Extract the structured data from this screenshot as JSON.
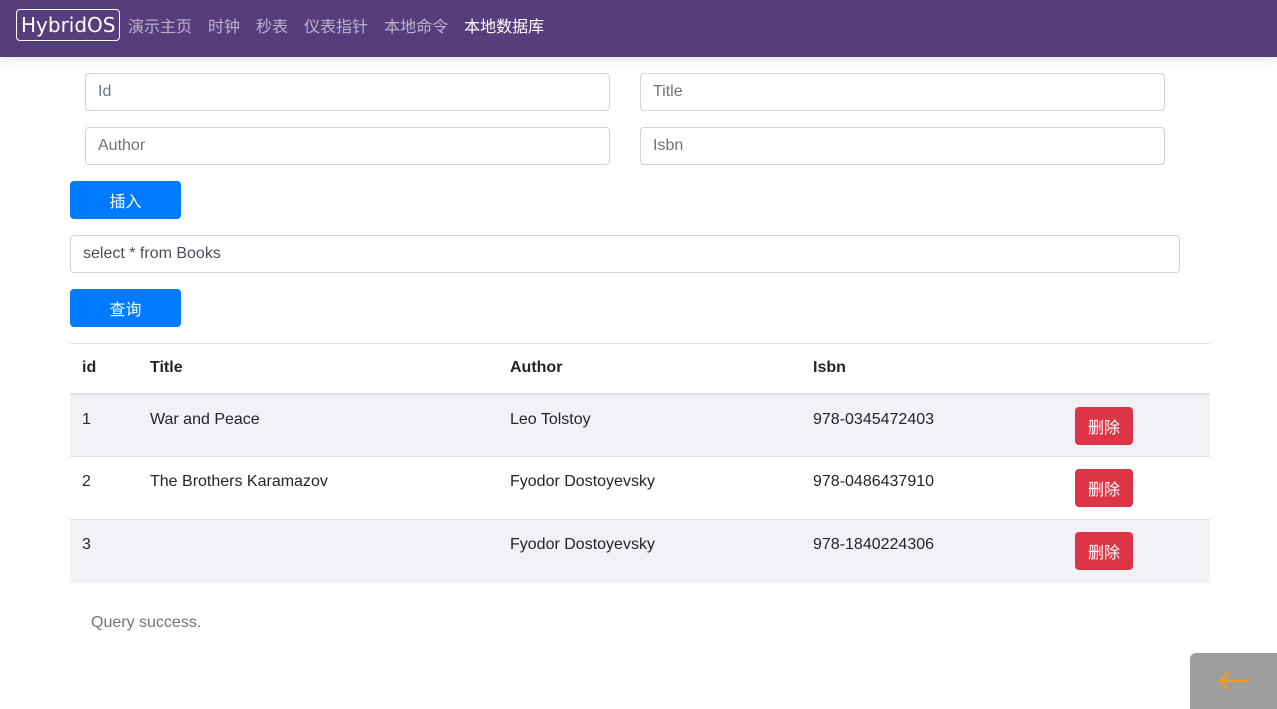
{
  "navbar": {
    "brand": "HybridOS",
    "links": [
      {
        "label": "演示主页",
        "active": false
      },
      {
        "label": "时钟",
        "active": false
      },
      {
        "label": "秒表",
        "active": false
      },
      {
        "label": "仪表指针",
        "active": false
      },
      {
        "label": "本地命令",
        "active": false
      },
      {
        "label": "本地数据库",
        "active": true
      }
    ]
  },
  "form": {
    "id": {
      "value": "",
      "placeholder": "Id"
    },
    "title": {
      "value": "",
      "placeholder": "Title"
    },
    "author": {
      "value": "",
      "placeholder": "Author"
    },
    "isbn": {
      "value": "",
      "placeholder": "Isbn"
    },
    "insert_label": "插入"
  },
  "query": {
    "value": "select * from Books",
    "button_label": "查询"
  },
  "table": {
    "headers": [
      "id",
      "Title",
      "Author",
      "Isbn"
    ],
    "rows": [
      {
        "id": "1",
        "title": "War and Peace",
        "author": "Leo Tolstoy",
        "isbn": "978-0345472403",
        "delete_label": "删除"
      },
      {
        "id": "2",
        "title": "The Brothers Karamazov",
        "author": "Fyodor Dostoyevsky",
        "isbn": "978-0486437910",
        "delete_label": "删除"
      },
      {
        "id": "3",
        "title": "",
        "author": "Fyodor Dostoyevsky",
        "isbn": "978-1840224306",
        "delete_label": "删除"
      }
    ]
  },
  "status": "Query success.",
  "back_button": {
    "icon": "arrow-left-icon",
    "icon_color": "#f39c12"
  },
  "colors": {
    "navbar": "#563d7c",
    "primary": "#007bff",
    "danger": "#dc3545",
    "stripe": "#f4f1f6"
  }
}
